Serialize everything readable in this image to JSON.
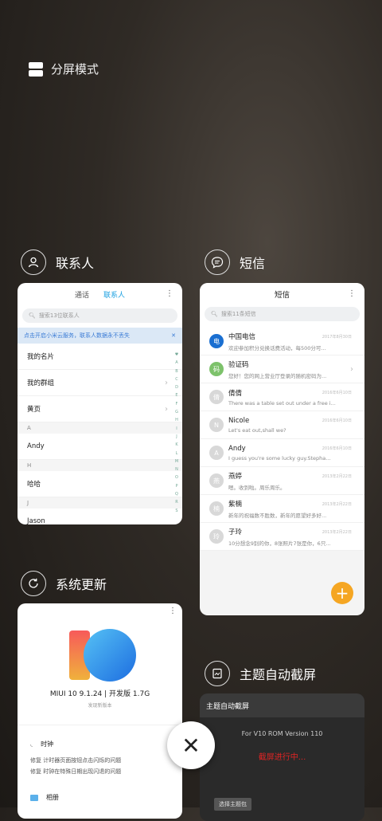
{
  "split_screen": {
    "label": "分屏模式"
  },
  "contacts_app": {
    "title": "联系人",
    "tabs": [
      "通话",
      "联系人"
    ],
    "active_tab": "联系人",
    "search_placeholder": "搜索13位联系人",
    "banner": "点击开启小米云服务，联系人数据永不丢失",
    "rows": [
      {
        "type": "item",
        "label": "我的名片"
      },
      {
        "type": "item",
        "label": "我的群组",
        "chevron": true
      },
      {
        "type": "item",
        "label": "黄页",
        "chevron": true
      },
      {
        "type": "header",
        "label": "A"
      },
      {
        "type": "item",
        "label": "Andy"
      },
      {
        "type": "header",
        "label": "H"
      },
      {
        "type": "item",
        "label": "哈哈"
      },
      {
        "type": "header",
        "label": "J"
      },
      {
        "type": "item",
        "label": "Jason"
      }
    ],
    "index_letters": [
      "♥",
      "A",
      "B",
      "C",
      "D",
      "E",
      "F",
      "G",
      "H",
      "I",
      "J",
      "K",
      "L",
      "M",
      "N",
      "O",
      "P",
      "Q",
      "R",
      "S"
    ]
  },
  "sms_app": {
    "title": "短信",
    "header": "短信",
    "search_placeholder": "搜索11条短信",
    "messages": [
      {
        "name": "中国电信",
        "preview": "欢迎参加积分兑换话费活动，每500分可...",
        "time": "2017年8月30日",
        "avatar": "电"
      },
      {
        "name": "验证码",
        "preview": "您好！您的网上营业厅登录的随机密码为...",
        "time": "",
        "avatar": "码"
      },
      {
        "name": "倩倩",
        "preview": "There was a table set out under a free i...",
        "time": "2016年6月10日",
        "avatar": "倩"
      },
      {
        "name": "Nicole",
        "preview": "Let's eat out,shall we?",
        "time": "2016年6月10日",
        "avatar": "N"
      },
      {
        "name": "Andy",
        "preview": "I guess you're some lucky guy.Stepha...",
        "time": "2016年6月10日",
        "avatar": "A"
      },
      {
        "name": "燕婷",
        "preview": "嗯。收到啦。周乐周乐。",
        "time": "2013年2月22日",
        "avatar": "燕"
      },
      {
        "name": "紫楠",
        "preview": "新年的祝福数不胜数，新年的愿望好多好...",
        "time": "2013年2月22日",
        "avatar": "楠"
      },
      {
        "name": "子玲",
        "preview": "10分想念9别的你，8张照片7张是你，6只...",
        "time": "2013年2月22日",
        "avatar": "玲"
      }
    ],
    "fab": "+"
  },
  "update_app": {
    "title": "系统更新",
    "version": "MIUI 10 9.1.24 | 开发版 1.7G",
    "new_label": "发现新版本",
    "logo_text": "10",
    "sections": [
      {
        "icon": "clock-icon",
        "name": "时钟",
        "lines": [
          "修复 计时器页面按钮点击闪烁的问题",
          "修复 时钟在特殊日期出现闪退的问题"
        ]
      },
      {
        "icon": "gallery-icon",
        "name": "相册",
        "lines": []
      }
    ]
  },
  "screenshot_app": {
    "title": "主题自动截屏",
    "bar_title": "主题自动截屏",
    "rom_version": "For V10 ROM Version 110",
    "status": "截屏进行中...",
    "button": "选择主题包"
  },
  "close_button": "✕"
}
